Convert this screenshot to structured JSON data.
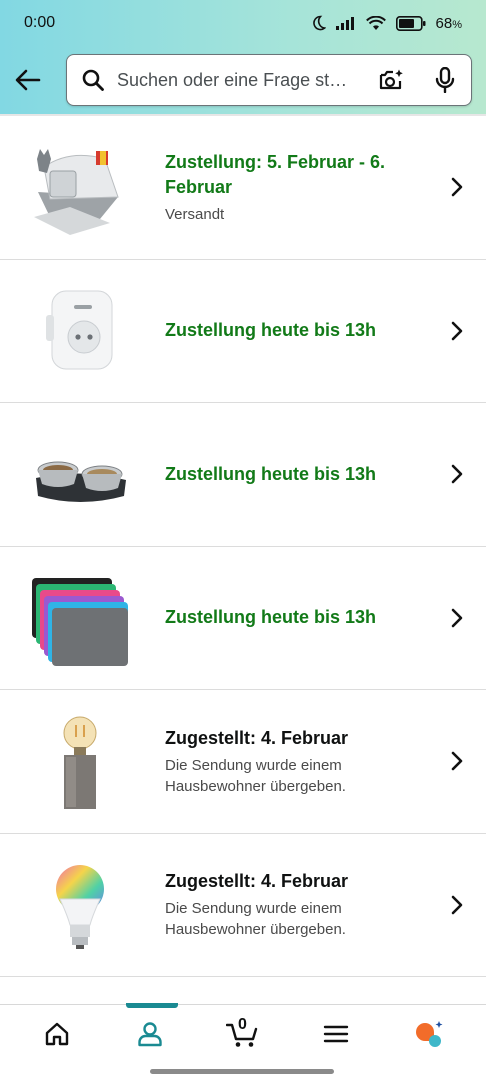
{
  "status_bar": {
    "time": "0:00",
    "battery": "68"
  },
  "search": {
    "placeholder": "Suchen oder eine Frage st…"
  },
  "orders": [
    {
      "title_line1": "Zustellung: 5. Februar - 6.",
      "title_line2": "Februar",
      "subtitle": "Versandt",
      "status_color": "#127a18"
    },
    {
      "title_line1": "Zustellung heute bis 13h",
      "status_color": "#127a18"
    },
    {
      "title_line1": "Zustellung heute bis 13h",
      "status_color": "#127a18"
    },
    {
      "title_line1": "Zustellung heute bis 13h",
      "status_color": "#127a18"
    },
    {
      "title_line1": "Zugestellt: 4. Februar",
      "subtitle_line1": "Die Sendung wurde einem",
      "subtitle_line2": "Hausbewohner übergeben.",
      "status_color": "#0f1111"
    },
    {
      "title_line1": "Zugestellt: 4. Februar",
      "subtitle_line1": "Die Sendung wurde einem",
      "subtitle_line2": "Hausbewohner übergeben.",
      "status_color": "#0f1111"
    }
  ],
  "bottom_nav": {
    "cart_count": "0",
    "active": "account",
    "accent": "#1a8a92"
  }
}
